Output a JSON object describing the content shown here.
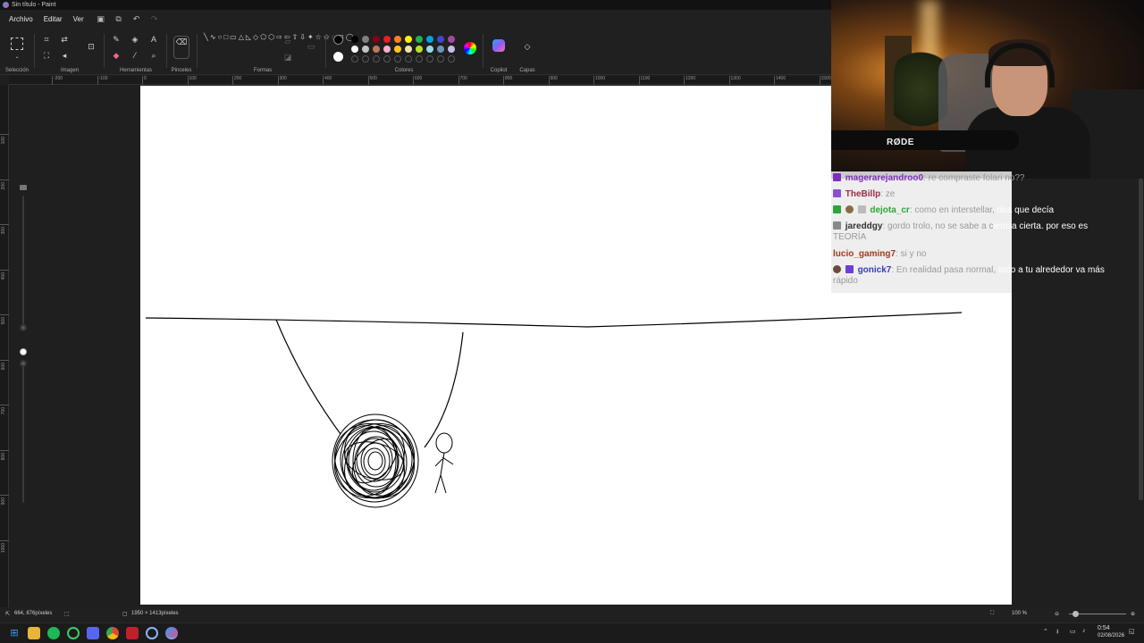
{
  "window": {
    "title": "Sin título - Paint"
  },
  "menu": {
    "items": [
      "Archivo",
      "Editar",
      "Ver"
    ]
  },
  "ribbon": {
    "groups": [
      "Selección",
      "Imagen",
      "Herramientas",
      "Pinceles",
      "Formas",
      "Colores",
      "Copilot",
      "Capas"
    ]
  },
  "colors": {
    "primary": "#000000",
    "secondary": "#ffffff",
    "palette_row1": [
      "#000000",
      "#7f7f7f",
      "#880015",
      "#ed1c24",
      "#ff7f27",
      "#fff200",
      "#22b14c",
      "#00a2e8",
      "#3f48cc",
      "#a349a4"
    ],
    "palette_row2": [
      "#ffffff",
      "#c3c3c3",
      "#b97a57",
      "#ffaec9",
      "#ffc90e",
      "#efe4b0",
      "#b5e61d",
      "#99d9ea",
      "#7092be",
      "#c8bfe7"
    ]
  },
  "ruler": {
    "top_labels": [
      "-200",
      "-100",
      "0",
      "100",
      "200",
      "300",
      "400",
      "500",
      "600",
      "700",
      "800",
      "900",
      "1000",
      "1100",
      "1200",
      "1300",
      "1400",
      "1500"
    ],
    "left_labels": [
      "100",
      "200",
      "300",
      "400",
      "500",
      "600",
      "700",
      "800",
      "900",
      "1000"
    ]
  },
  "chat": [
    {
      "user": "magerarejandroo0",
      "message": "re compraste folari no??",
      "user_color": "#7b2fbf"
    },
    {
      "user": "TheBillp",
      "message": "ze",
      "user_color": "#9b2a4a"
    },
    {
      "user": "dejota_cr",
      "message": "como en interstellar, ",
      "message2": "dea que decía",
      "user_color": "#2fa33a"
    },
    {
      "user": "jareddgy",
      "message": "gordo trolo, no se sabe a c",
      "message2": "iencia cierta. por eso es",
      "message3": "TEORÍA",
      "user_color": "#333333"
    },
    {
      "user": "lucio_gaming7",
      "message": "si y no",
      "user_color": "#a03a1e"
    },
    {
      "user": "gonick7",
      "message": "En realidad pasa normal, ",
      "message2": "todo a tu alrededor va más",
      "message3": "rápido",
      "user_color": "#3a3abf"
    }
  ],
  "webcam": {
    "mic_label": "RØDE"
  },
  "status": {
    "cursor": "664, 876píxeles",
    "canvas_size": "1950 × 1413píxeles",
    "zoom": "100 %"
  },
  "taskbar": {
    "time": "0:54",
    "date": "02/08/2026"
  }
}
